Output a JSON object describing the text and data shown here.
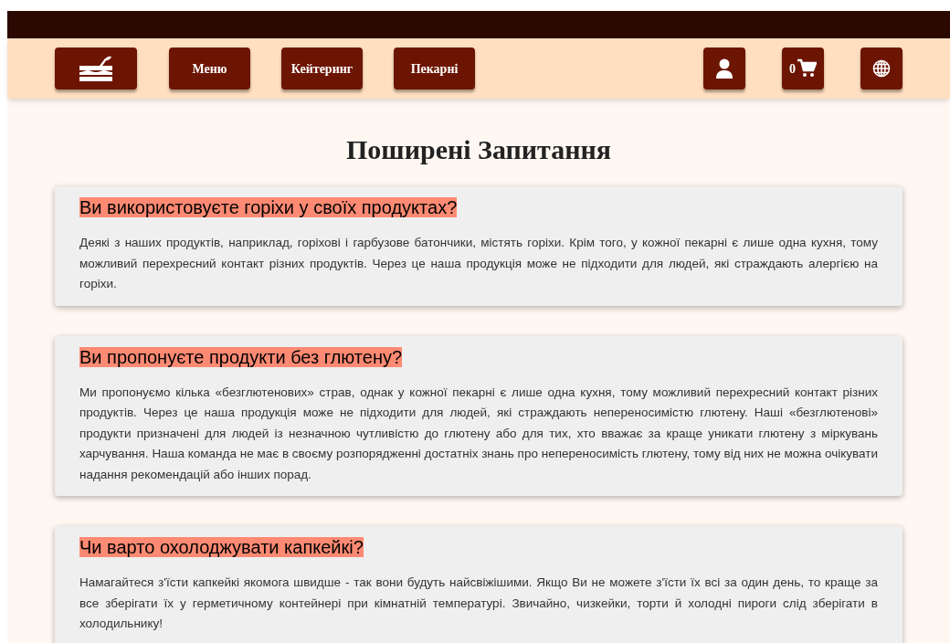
{
  "nav": {
    "links": [
      {
        "label": "Меню"
      },
      {
        "label": "Кейтеринг"
      },
      {
        "label": "Пекарні"
      }
    ],
    "cart_count": "0"
  },
  "title": "Поширені Запитання",
  "faq": [
    {
      "question": "Ви використовуєте горіхи у своїх продуктах?",
      "answer": "Деякі з наших продуктів, наприклад, горіхові і гарбузове батончики, містять горіхи. Крім того, у кожної пекарні є лише одна кухня, тому можливий перехресний контакт різних продуктів. Через це наша продукція може не підходити для людей, які страждають алергією на горіхи."
    },
    {
      "question": "Ви пропонуєте продукти без глютену?",
      "answer": "Ми пропонуємо кілька «безглютенових» страв, однак у кожної пекарні є лише одна кухня, тому можливий перехресний контакт різних продуктів. Через це наша продукція може не підходити для людей, які страждають непереносимістю глютену. Наші «безглютенові» продукти призначені для людей із незначною чутливістю до глютену або для тих, хто вважає за краще уникати глютену з міркувань харчування. Наша команда не має в своєму розпорядженні достатніх знань про непереносимість глютену, тому від них не можна очікувати надання рекомендацій або інших порад."
    },
    {
      "question": "Чи варто охолоджувати капкейкі?",
      "answer": "Намагайтеся з'їсти капкейкі якомога швидше - так вони будуть найсвіжішими. Якщо Ви не можете з'їсти їх всі за один день, то краще за все зберігати їх у герметичному контейнері при кімнатній температурі. Звичайно, чизкейки, торти й холодні пироги слід зберігати в холодильнику!"
    }
  ]
}
